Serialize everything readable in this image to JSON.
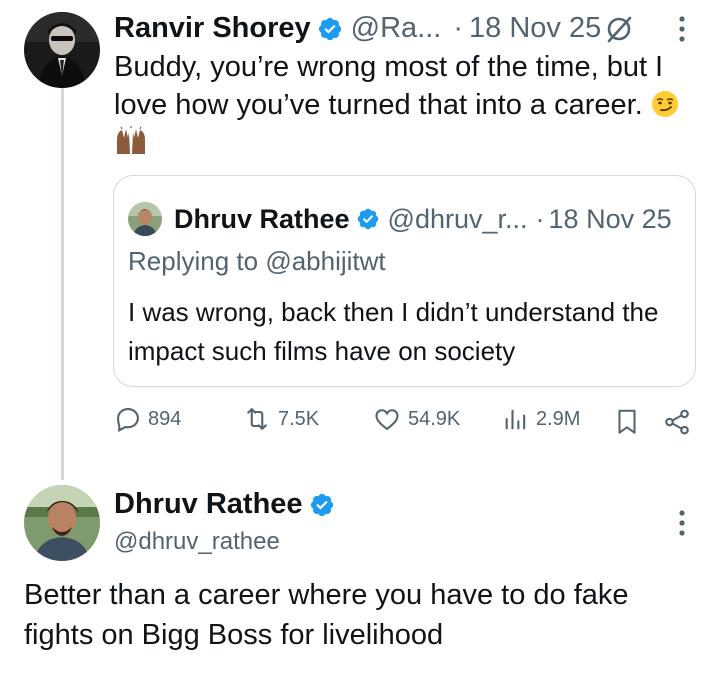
{
  "original_tweet": {
    "author_name": "Ranvir Shorey",
    "author_handle": "@Ra...",
    "separator": "·",
    "timestamp": "18 Nov 25",
    "text": "Buddy, you’re wrong most of the time, but I love how you’ve turned that into a career.",
    "emojis": [
      "smirking-face",
      "raising-hands-medium-dark-skin"
    ],
    "quoted_tweet": {
      "author_name": "Dhruv Rathee",
      "author_handle": "@dhruv_r...",
      "separator": "·",
      "timestamp": "18 Nov 25",
      "replying_to_prefix": "Replying to",
      "replying_to_handle": "@abhijitwt",
      "text": "I was wrong, back then I didn’t understand the impact such films have on society"
    },
    "actions": {
      "replies": "894",
      "reposts": "7.5K",
      "likes": "54.9K",
      "views": "2.9M"
    }
  },
  "reply_tweet": {
    "author_name": "Dhruv Rathee",
    "author_handle": "@dhruv_rathee",
    "text": "Better than a career where you have to do fake fights on Bigg Boss for livelihood"
  },
  "colors": {
    "text_primary": "#0f1419",
    "text_secondary": "#536471",
    "verified_blue": "#1d9bf0",
    "border": "#cfd9de"
  }
}
